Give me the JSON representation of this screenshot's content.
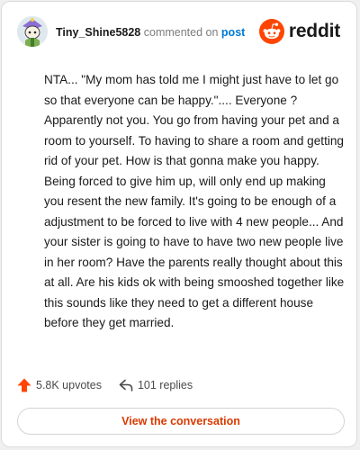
{
  "header": {
    "username": "Tiny_Shine5828",
    "action_text": "commented on",
    "post_link": "post",
    "avatar_icon": "snoo-avatar-icon",
    "brand_name": "reddit",
    "brand_icon": "reddit-alien-icon",
    "brand_color": "#ff4500"
  },
  "comment": {
    "body": "NTA... \"My mom has told me I might just have to let go so that everyone can be happy.\".... Everyone ? Apparently not you. You go from having your pet and a room to yourself. To having to share a room and getting rid of your pet. How is that gonna make you happy. Being forced to give him up, will only end up making you resent the new family. It's going to be enough of a adjustment to be forced to live with 4 new people... And your sister is going to have to have two new people live in her room? Have the parents really thought about this at all. Are his kids ok with being smooshed together like this sounds like they need to get a different house before they get married."
  },
  "footer": {
    "upvotes": "5.8K upvotes",
    "upvote_icon": "upvote-arrow-icon",
    "upvote_color": "#ff4500",
    "replies": "101 replies",
    "reply_icon": "reply-arrow-icon",
    "cta_label": "View the conversation",
    "cta_color": "#d93a00"
  }
}
